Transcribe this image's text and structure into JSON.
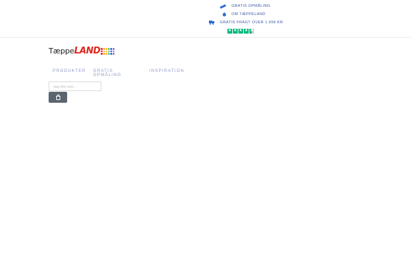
{
  "top_bar": {
    "usps": [
      {
        "label": "GRATIS OPMÅLING",
        "icon": "ruler-icon"
      },
      {
        "label": "OM TÆPPELAND",
        "icon": "drop-icon"
      },
      {
        "label": "GRATIS FRAGT OVER 1.999 KR.",
        "icon": "truck-icon"
      }
    ],
    "rating": {
      "stars_filled": 4.5,
      "stars_total": 5,
      "color": "#00b67a"
    }
  },
  "logo": {
    "text_part1": "Tæppe",
    "text_part2": "LAND",
    "brand_color": "#e3241b"
  },
  "nav": {
    "items": [
      "PRODUKTER",
      "GRATIS OPMÅLING",
      "INSPIRATION"
    ]
  },
  "search": {
    "placeholder": "Søg efter varer…",
    "button_icon": "shopping-bag-icon"
  },
  "colors": {
    "nav_text": "#8f97c6",
    "usp_text": "#3c56a8",
    "button_bg": "#5b6570"
  }
}
